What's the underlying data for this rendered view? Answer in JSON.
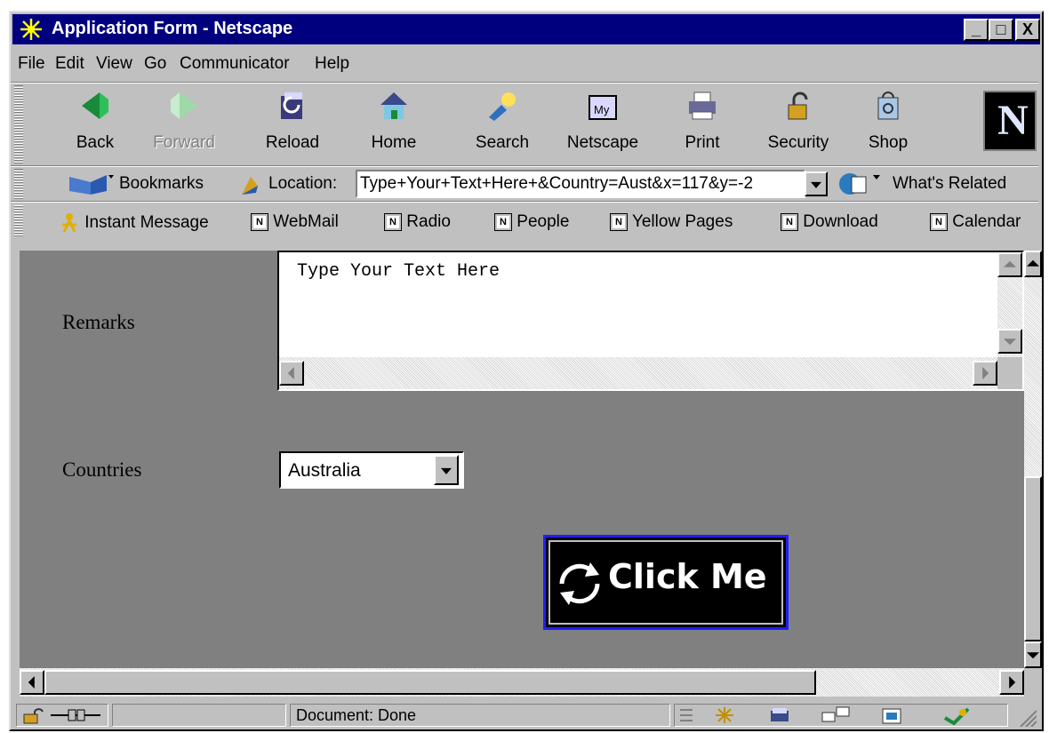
{
  "window": {
    "title": "Application Form - Netscape"
  },
  "window_controls": {
    "minimize": "_",
    "maximize": "□",
    "close": "X"
  },
  "menu": [
    "File",
    "Edit",
    "View",
    "Go",
    "Communicator",
    "Help"
  ],
  "nav_toolbar": [
    {
      "label": "Back",
      "icon": "back-arrow-icon",
      "enabled": true
    },
    {
      "label": "Forward",
      "icon": "forward-arrow-icon",
      "enabled": false
    },
    {
      "label": "Reload",
      "icon": "reload-icon",
      "enabled": true
    },
    {
      "label": "Home",
      "icon": "home-icon",
      "enabled": true
    },
    {
      "label": "Search",
      "icon": "search-icon",
      "enabled": true
    },
    {
      "label": "Netscape",
      "icon": "my-netscape-icon",
      "enabled": true
    },
    {
      "label": "Print",
      "icon": "print-icon",
      "enabled": true
    },
    {
      "label": "Security",
      "icon": "security-lock-icon",
      "enabled": true
    },
    {
      "label": "Shop",
      "icon": "shop-bag-icon",
      "enabled": true
    }
  ],
  "brand": {
    "logo_letter": "N"
  },
  "location_bar": {
    "bookmarks_label": "Bookmarks",
    "location_label": "Location:",
    "url": "Type+Your+Text+Here+&Country=Aust&x=117&y=-2",
    "whats_related_label": "What's Related"
  },
  "personal_toolbar": [
    "Instant Message",
    "WebMail",
    "Radio",
    "People",
    "Yellow Pages",
    "Download",
    "Calendar"
  ],
  "form": {
    "remarks_label": "Remarks",
    "remarks_value": "Type Your Text Here",
    "countries_label": "Countries",
    "countries_selected": "Australia",
    "submit_label": "Click Me"
  },
  "status": {
    "text": "Document: Done"
  },
  "colors": {
    "titlebar": "#00007f",
    "content_bg": "#808080",
    "chrome": "#c0c0c0",
    "button_border": "#1f1fff"
  }
}
